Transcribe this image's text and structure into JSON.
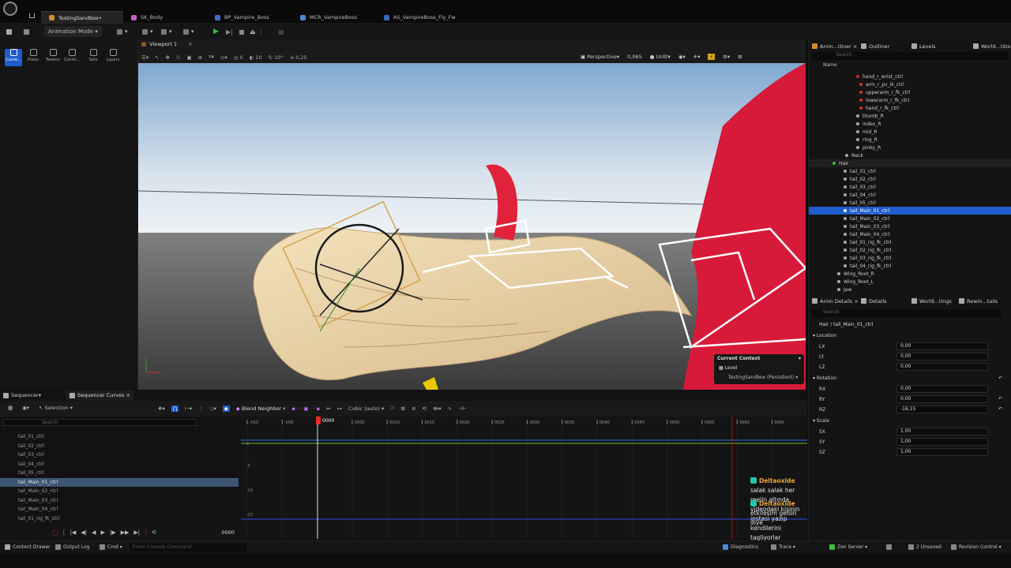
{
  "tabs": [
    "TestingSandbox•",
    "SK_Body",
    "BP_Vampire_Boss",
    "MCR_VampireBoss",
    "AS_VampireBoss_Fly_Fw"
  ],
  "toolbar": {
    "mode": "Animation Mode"
  },
  "modes": [
    "Curve...",
    "Poses",
    "Tweens",
    "Constr...",
    "Sets",
    "Layers"
  ],
  "viewport": {
    "tab": "Viewport 1",
    "perspective": "Perspective",
    "fov": "0,065",
    "lit": "Unlit",
    "snap1": "0",
    "snap2": "10",
    "snap3": "10°",
    "snap4": "0,25"
  },
  "context": {
    "title": "Current Context",
    "level_label": "Level",
    "level": "TestingSandbox (Persistent)"
  },
  "outliner": {
    "tabs": [
      "Anim...tliner",
      "Outliner",
      "Levels",
      "World...tition"
    ],
    "search": "Search",
    "col": "Name",
    "items": [
      "hand_r_wrist_ctrl",
      "arm_r_pv_ik_ctrl",
      "upperarm_r_fk_ctrl",
      "lowerarm_r_fk_ctrl",
      "hand_r_fk_ctrl",
      "thumb_R",
      "index_R",
      "mid_R",
      "ring_R",
      "pinky_R",
      "Neck",
      "Hair",
      "tail_01_ctrl",
      "tail_02_ctrl",
      "tail_03_ctrl",
      "tail_04_ctrl",
      "tail_05_ctrl",
      "tail_Main_01_ctrl",
      "tail_Main_02_ctrl",
      "tail_Main_03_ctrl",
      "tail_Main_04_ctrl",
      "tail_01_rig_fk_ctrl",
      "tail_02_rig_fk_ctrl",
      "tail_03_rig_fk_ctrl",
      "tail_04_rig_fk_ctrl",
      "Wing_Root_R",
      "Wing_Root_L",
      "Jaw"
    ]
  },
  "details": {
    "tabs": [
      "Anim Details",
      "Details",
      "World...tings",
      "Rewin...tails"
    ],
    "search": "Search",
    "path": "Hair / tail_Main_01_ctrl",
    "location": "Location",
    "rotation": "Rotation",
    "scale": "Scale",
    "lx": "0,00",
    "ly": "0,00",
    "lz": "0,00",
    "rx": "0,00",
    "ry": "0,00",
    "rz": "-16,15",
    "sx": "1,00",
    "sy": "1,00",
    "sz": "1,00"
  },
  "sequencer": {
    "tab1": "Sequencer",
    "tab2": "Sequencer Curves",
    "selection": "Selection",
    "blend": "Blend Neighbor",
    "interp": "Cubic (auto)",
    "search": "Search",
    "list": [
      "tail_01_ctrl",
      "tail_02_ctrl",
      "tail_03_ctrl",
      "tail_04_ctrl",
      "tail_05_ctrl",
      "tail_Main_01_ctrl",
      "tail_Main_02_ctrl",
      "tail_Main_03_ctrl",
      "tail_Main_04_ctrl",
      "tail_01_rig_fk_ctrl"
    ],
    "ruler": [
      "-010",
      "-005",
      "0000",
      "0005",
      "0010",
      "0015",
      "0020",
      "0025",
      "0030",
      "0035",
      "0040",
      "0045",
      "0050",
      "0055",
      "0060",
      "0065"
    ],
    "yticks": [
      "0",
      "-5",
      "-10",
      "-15"
    ],
    "frame": "0000"
  },
  "chat": [
    {
      "user": "Deltaoxide",
      "msg": "salak salak her reelin altında videodaki kişinin instası yazıp kendilerini tagliyorlar"
    },
    {
      "user": "Deltaoxide",
      "msg": "etkileşim gelsin diye"
    }
  ],
  "status": {
    "drawer": "Content Drawer",
    "log": "Output Log",
    "cmd": "Cmd",
    "console": "Enter Console Command",
    "diag": "Diagnostics",
    "trace": "Trace",
    "zen": "Zen Server",
    "unsaved": "2 Unsaved",
    "rev": "Revision Control"
  }
}
